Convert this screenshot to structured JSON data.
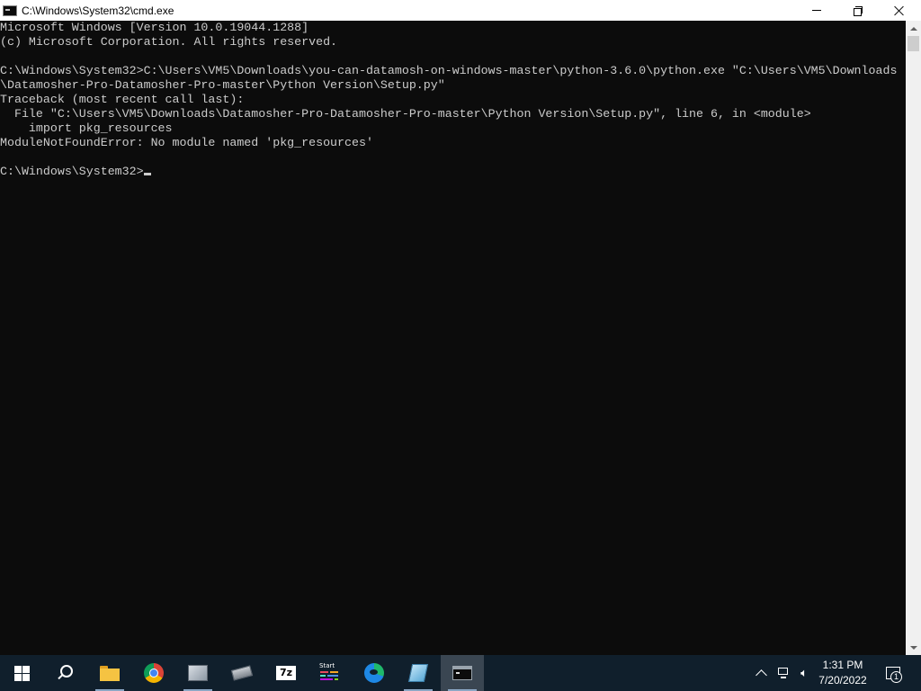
{
  "window": {
    "title": "C:\\Windows\\System32\\cmd.exe"
  },
  "console": {
    "lines": [
      "Microsoft Windows [Version 10.0.19044.1288]",
      "(c) Microsoft Corporation. All rights reserved.",
      "",
      "C:\\Windows\\System32>C:\\Users\\VM5\\Downloads\\you-can-datamosh-on-windows-master\\python-3.6.0\\python.exe \"C:\\Users\\VM5\\Downloads",
      "\\Datamosher-Pro-Datamosher-Pro-master\\Python Version\\Setup.py\"",
      "Traceback (most recent call last):",
      "  File \"C:\\Users\\VM5\\Downloads\\Datamosher-Pro-Datamosher-Pro-master\\Python Version\\Setup.py\", line 6, in <module>",
      "    import pkg_resources",
      "ModuleNotFoundError: No module named 'pkg_resources'",
      "",
      "C:\\Windows\\System32>"
    ]
  },
  "taskbar": {
    "icons": [
      "windows-logo-icon",
      "search-icon",
      "file-explorer-icon",
      "chrome-icon",
      "gray-app-icon",
      "gray-app-2-icon",
      "7zip-icon",
      "start-app-icon",
      "edge-icon",
      "notepad-icon",
      "cmd-icon"
    ],
    "sevenzip_label": "7z",
    "start_app_label": "Start",
    "colors": {
      "background": "#101f2c",
      "active": "#3a4652"
    }
  },
  "tray": {
    "time": "1:31 PM",
    "date": "7/20/2022",
    "notification_count": "1"
  },
  "colors": {
    "console_background": "#0c0c0c",
    "console_text": "#cccccc"
  }
}
